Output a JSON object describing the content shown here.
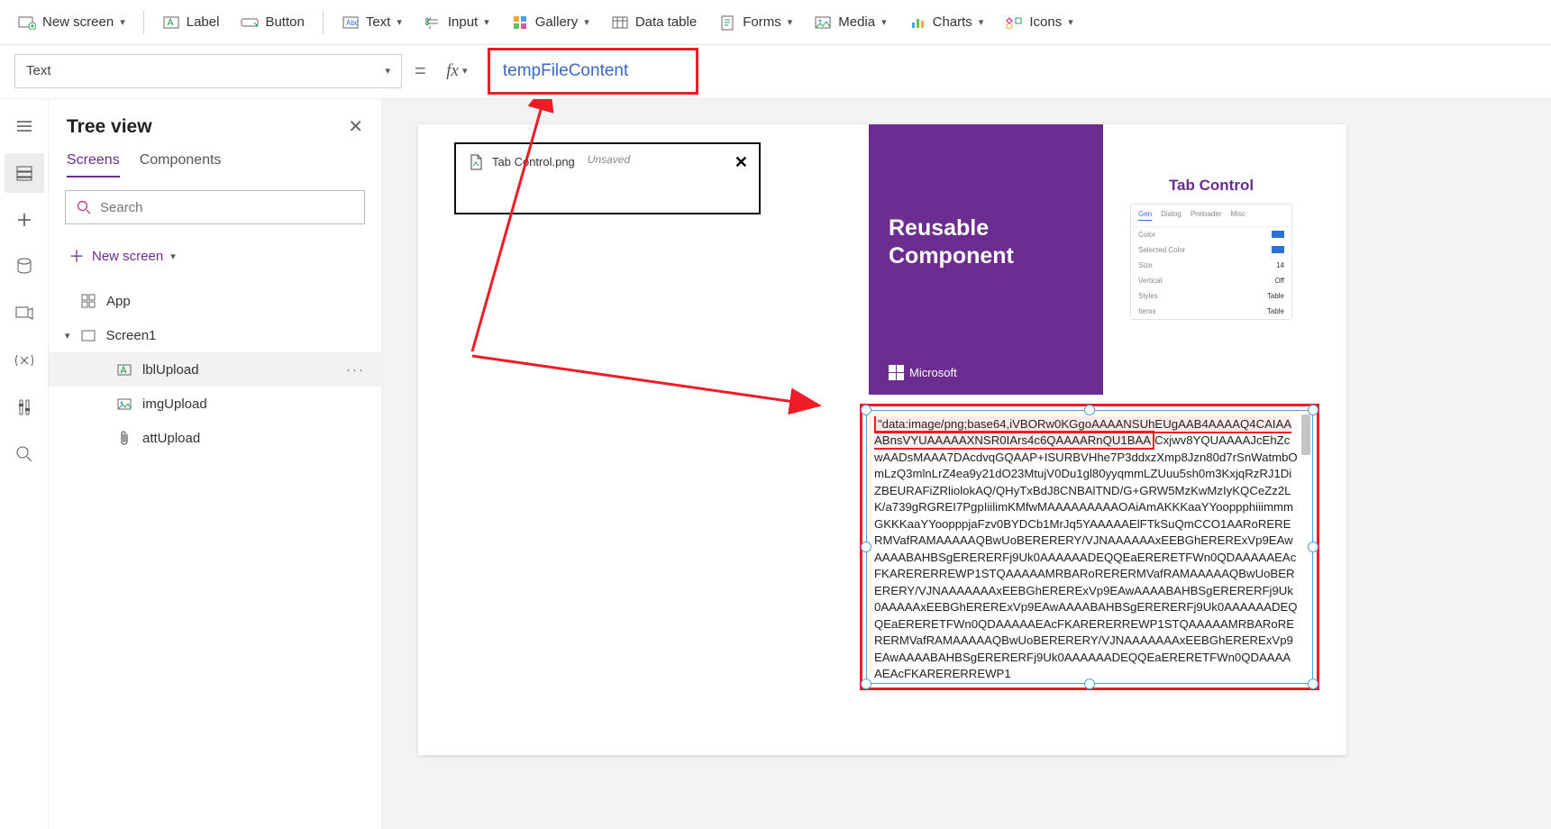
{
  "toolbar": {
    "new_screen": "New screen",
    "label": "Label",
    "button": "Button",
    "text": "Text",
    "input": "Input",
    "gallery": "Gallery",
    "data_table": "Data table",
    "forms": "Forms",
    "media": "Media",
    "charts": "Charts",
    "icons": "Icons"
  },
  "formula": {
    "property": "Text",
    "equals": "=",
    "fx": "fx",
    "expression": "tempFileContent"
  },
  "tree": {
    "title": "Tree view",
    "tabs": {
      "screens": "Screens",
      "components": "Components"
    },
    "search_placeholder": "Search",
    "new_screen": "New screen",
    "app": "App",
    "screen1": "Screen1",
    "items": {
      "lblUpload": "lblUpload",
      "imgUpload": "imgUpload",
      "attUpload": "attUpload"
    },
    "more": "···"
  },
  "canvas": {
    "file_chip": {
      "name": "Tab Control.png",
      "state": "Unsaved"
    },
    "purple_card": {
      "line1": "Reusable",
      "line2": "Component",
      "brand": "Microsoft"
    },
    "tab_preview": {
      "title": "Tab Control",
      "tabs": [
        "Gen",
        "Dialog",
        "Preloader",
        "Misc"
      ],
      "rows": [
        {
          "k": "Color",
          "v": ""
        },
        {
          "k": "Selected Color",
          "v": ""
        },
        {
          "k": "Size",
          "v": "14"
        },
        {
          "k": "Vertical",
          "v": "Off"
        },
        {
          "k": "Styles",
          "v": "Table"
        },
        {
          "k": "Items",
          "v": "Table"
        }
      ]
    },
    "b64_highlight": "\"data:image/png;base64,iVBORw0KGgoAAAANSUhEUgAAB4AAAAQ4CAIAAABnsVYUAAAAAXNSR0IArs4c6QAAAARnQU1BAA",
    "b64_rest": "Cxjwv8YQUAAAAJcEhZcwAADsMAAA7DAcdvqGQAAP+ISURBVHhe7P3ddxzXmp8Jzn80d7rSnWatmbOmLzQ3mlnLrZ4ea9y21dO23MtujV0Du1gl80yyqmmLZUuu5sh0m3KxjqRzRJ1DiZBEURAFiZRliolokAQ/QHyTxBdJ8CNBAlTND/G+GRW5MzKwMzIyKQCeZz2LK/a739gRGREI7PgpIiilimKMfwMAAAAAAAAAOAiAmAKKKaaYYooppphiiimmmGKKKaaYYoopppjaFzv0BYDCb1MrJq5YAAAAAElFTkSuQmCCO1AARoRERERMVafRAMAAAAAQBwUoBERERERY/VJNAAAAAAxEEBGhERERExVp9EAwAAAABAHBSgERERERFj9Uk0AAAAAADEQQEaERERETFWn0QDAAAAAEAcFKARERERREWP1STQAAAAAMRBARoRERERMVafRAMAAAAAQBwUoBERERERY/VJNAAAAAAAxEEBGhERERExVp9EAwAAAABAHBSgERERERFj9Uk0AAAAAxEEBGhERERExVp9EAwAAAABAHBSgERERERFj9Uk0AAAAAADEQQEaERERETFWn0QDAAAAAEAcFKARERERREWP1STQAAAAAMRBARoRERERMVafRAMAAAAAQBwUoBERERERY/VJNAAAAAAAxEEBGhERERExVp9EAwAAAABAHBSgERERERFj9Uk0AAAAAADEQQEaERERETFWn0QDAAAAAEAcFKARERERREWP1"
  }
}
